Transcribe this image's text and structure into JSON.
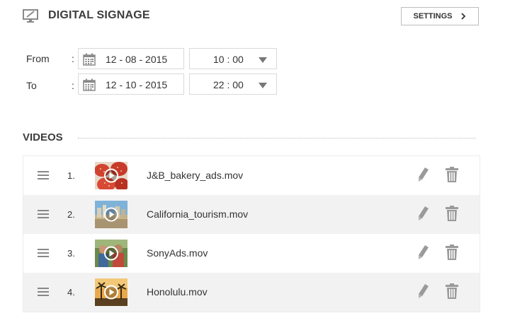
{
  "header": {
    "title": "DIGITAL SIGNAGE",
    "settings_label": "SETTINGS"
  },
  "schedule": {
    "from": {
      "label": "From",
      "colon": ":",
      "date": "12 - 08 - 2015",
      "time": "10 : 00"
    },
    "to": {
      "label": "To",
      "colon": ":",
      "date": "12 - 10 - 2015",
      "time": "22 : 00"
    }
  },
  "videos_section": {
    "title": "VIDEOS",
    "items": [
      {
        "number": "1.",
        "filename": "J&B_bakery_ads.mov",
        "thumbnail": "strawberries"
      },
      {
        "number": "2.",
        "filename": "California_tourism.mov",
        "thumbnail": "city-skyline"
      },
      {
        "number": "3.",
        "filename": "SonyAds.mov",
        "thumbnail": "people-outdoors"
      },
      {
        "number": "4.",
        "filename": "Honolulu.mov",
        "thumbnail": "palm-sunset"
      }
    ]
  },
  "icons": {
    "monitor": "monitor-icon",
    "calendar": "calendar-icon",
    "dropdown": "dropdown-arrow-icon",
    "drag": "drag-handle-icon",
    "play": "play-icon",
    "edit": "pencil-icon",
    "delete": "trash-icon",
    "chevron": "chevron-right-icon"
  },
  "colors": {
    "icon_gray": "#9a9a9a",
    "row_alt": "#f2f2f2",
    "border": "#d9d9d9"
  }
}
